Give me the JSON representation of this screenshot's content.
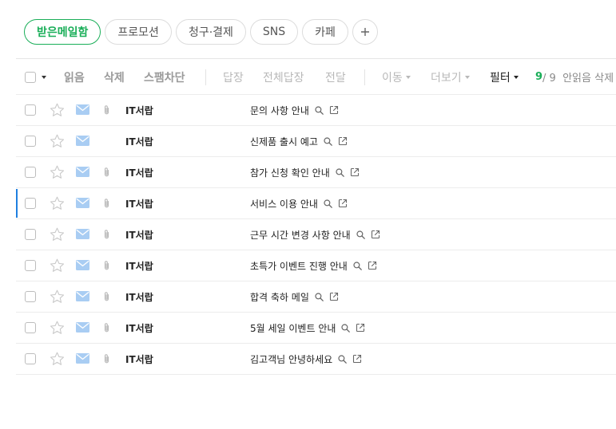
{
  "tabs": [
    {
      "label": "받은메일함",
      "active": true
    },
    {
      "label": "프로모션",
      "active": false
    },
    {
      "label": "청구·결제",
      "active": false
    },
    {
      "label": "SNS",
      "active": false
    },
    {
      "label": "카페",
      "active": false
    }
  ],
  "toolbar": {
    "read": "읽음",
    "delete": "삭제",
    "block_spam": "스팸차단",
    "reply": "답장",
    "reply_all": "전체답장",
    "forward": "전달",
    "move": "이동",
    "more": "더보기",
    "filter": "필터",
    "count_current": "9",
    "count_rest": "/ 9  안읽음 삭제"
  },
  "colors": {
    "accent": "#19ae58",
    "envelope": "#a9cdf3",
    "selected_marker": "#1f7fe0"
  },
  "mails": [
    {
      "sender": "IT서랍",
      "subject": "문의 사항 안내",
      "attachment": true,
      "marked": false
    },
    {
      "sender": "IT서랍",
      "subject": "신제품 출시 예고",
      "attachment": false,
      "marked": false
    },
    {
      "sender": "IT서랍",
      "subject": "참가 신청 확인 안내",
      "attachment": true,
      "marked": false
    },
    {
      "sender": "IT서랍",
      "subject": "서비스 이용 안내",
      "attachment": true,
      "marked": true
    },
    {
      "sender": "IT서랍",
      "subject": "근무 시간 변경 사항 안내",
      "attachment": true,
      "marked": false
    },
    {
      "sender": "IT서랍",
      "subject": "초특가 이벤트 진행 안내",
      "attachment": true,
      "marked": false
    },
    {
      "sender": "IT서랍",
      "subject": "합격 축하 메일",
      "attachment": true,
      "marked": false
    },
    {
      "sender": "IT서랍",
      "subject": "5월 세일 이벤트 안내",
      "attachment": true,
      "marked": false
    },
    {
      "sender": "IT서랍",
      "subject": "김고객님 안녕하세요",
      "attachment": true,
      "marked": false
    }
  ]
}
